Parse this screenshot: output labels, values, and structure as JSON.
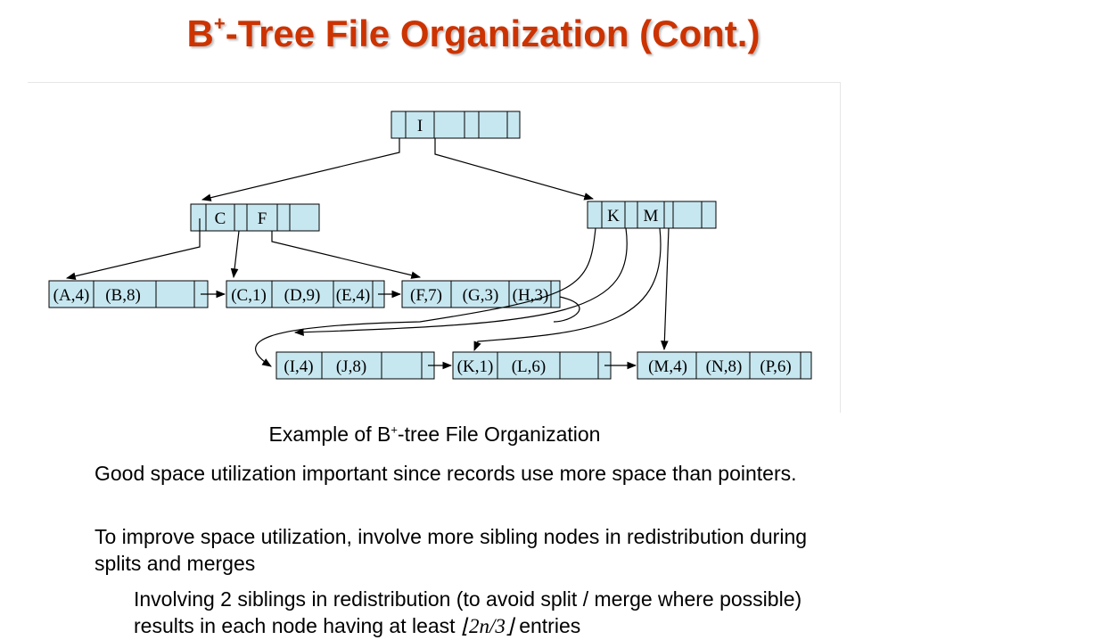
{
  "slide": {
    "title_prefix": "B",
    "title_sup": "+",
    "title_suffix": "-Tree File Organization (Cont.)",
    "caption_prefix": "Example of B",
    "caption_sup": "+",
    "caption_suffix": "-tree File Organization",
    "bullets": [
      "Good space utilization important since records use more space than pointers.",
      "To improve space utilization, involve more sibling nodes in redistribution during splits and merges"
    ],
    "sub_bullet_prefix": "Involving 2 siblings in redistribution (to avoid split / merge where possible) results in each node having at least",
    "sub_bullet_math": "⌊2n/3⌋",
    "sub_bullet_suffix": "entries"
  },
  "tree": {
    "root": {
      "keys": [
        "I"
      ]
    },
    "internal": [
      {
        "id": "left",
        "keys": [
          "C",
          "F"
        ]
      },
      {
        "id": "right",
        "keys": [
          "K",
          "M"
        ]
      }
    ],
    "leaves": [
      {
        "id": "leaf1",
        "records": [
          "(A,4)",
          "(B,8)"
        ]
      },
      {
        "id": "leaf2",
        "records": [
          "(C,1)",
          "(D,9)",
          "(E,4)"
        ]
      },
      {
        "id": "leaf3",
        "records": [
          "(F,7)",
          "(G,3)",
          "(H,3)"
        ]
      },
      {
        "id": "leaf4",
        "records": [
          "(I,4)",
          "(J,8)"
        ]
      },
      {
        "id": "leaf5",
        "records": [
          "(K,1)",
          "(L,6)"
        ]
      },
      {
        "id": "leaf6",
        "records": [
          "(M,4)",
          "(N,8)",
          "(P,6)"
        ]
      }
    ],
    "colors": {
      "node_fill": "#c7e7f0",
      "line": "#000000"
    }
  }
}
